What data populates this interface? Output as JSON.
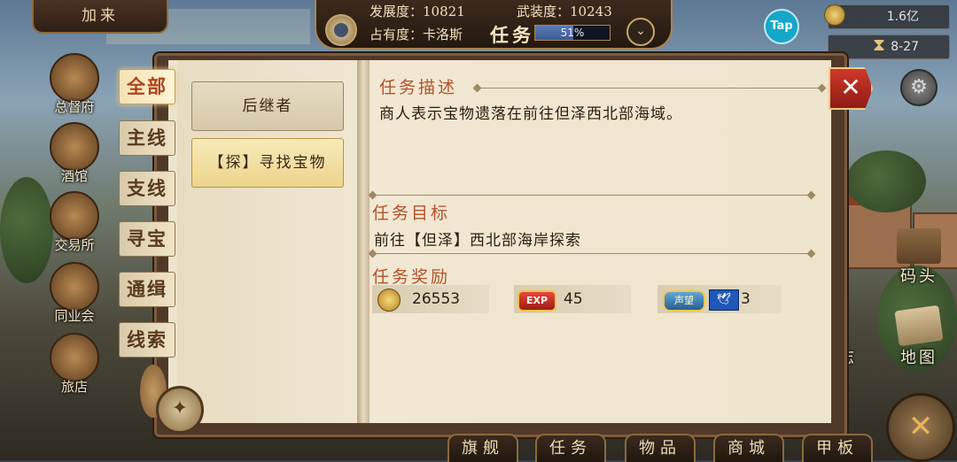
{
  "header": {
    "player_name": "加来",
    "development_label": "发展度：",
    "development_value": "10821",
    "military_label": "武装度：",
    "military_value": "10243",
    "occupancy_label": "占有度：",
    "occupancy_city": "卡洛斯",
    "screen_title": "任务",
    "occupancy_percent_text": "51%",
    "occupancy_fraction": 0.51,
    "tap_badge": "Tap",
    "gold_amount": "1.6亿",
    "date": "8-27"
  },
  "left_buildings": [
    {
      "label": "总督府",
      "icon": "crown-icon"
    },
    {
      "label": "酒馆",
      "icon": "beer-mug-icon"
    },
    {
      "label": "交易所",
      "icon": "scales-icon"
    },
    {
      "label": "同业会",
      "icon": "anchor-badge-icon"
    },
    {
      "label": "旅店",
      "icon": "inn-basket-icon"
    }
  ],
  "right_side": {
    "dock_label": "码头",
    "map_label": "地图",
    "partial_label": "志"
  },
  "categories": [
    {
      "label": "全部",
      "active": true
    },
    {
      "label": "主线",
      "active": false
    },
    {
      "label": "支线",
      "active": false
    },
    {
      "label": "寻宝",
      "active": false
    },
    {
      "label": "通缉",
      "active": false
    },
    {
      "label": "线索",
      "active": false
    }
  ],
  "quests": [
    {
      "label": "后继者",
      "selected": false
    },
    {
      "label": "【探】寻找宝物",
      "selected": true
    }
  ],
  "detail": {
    "description_title": "任务描述",
    "description_text": "商人表示宝物遗落在前往但泽西北部海域。",
    "objective_title": "任务目标",
    "objective_text": "前往【但泽】西北部海岸探索",
    "rewards_title": "任务奖励",
    "rewards": {
      "gold": "26553",
      "exp_badge": "EXP",
      "exp": "45",
      "fame_badge": "声望",
      "fame": "3"
    }
  },
  "bottom_nav": [
    "旗舰",
    "任务",
    "物品",
    "商城",
    "甲板"
  ],
  "colors": {
    "section_title": "#b3532b",
    "close_button": "#c8302a",
    "active_tab_text": "#b0431e"
  }
}
